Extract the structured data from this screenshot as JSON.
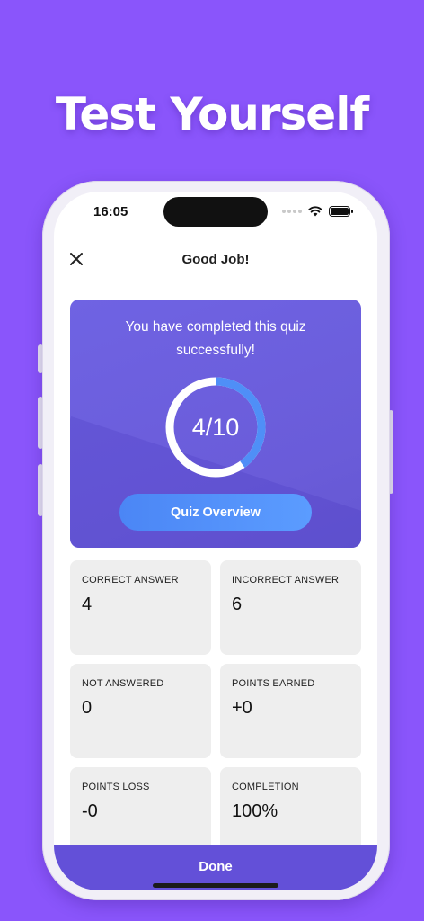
{
  "marketing": {
    "headline": "Test Yourself"
  },
  "status_bar": {
    "time": "16:05"
  },
  "nav": {
    "title": "Good Job!",
    "close_icon": "close-icon"
  },
  "result": {
    "message": "You have completed this quiz successfully!",
    "score_text": "4/10",
    "score_fraction": 0.4,
    "overview_button": "Quiz Overview"
  },
  "stats": [
    {
      "label": "CORRECT ANSWER",
      "value": "4"
    },
    {
      "label": "INCORRECT ANSWER",
      "value": "6"
    },
    {
      "label": "NOT ANSWERED",
      "value": "0"
    },
    {
      "label": "POINTS EARNED",
      "value": "+0"
    },
    {
      "label": "POINTS LOSS",
      "value": "-0"
    },
    {
      "label": "COMPLETION",
      "value": "100%"
    }
  ],
  "footer": {
    "done_label": "Done"
  },
  "colors": {
    "background": "#8a55fb",
    "card": "#6a5cd9",
    "accent_blue": "#4f8ff7",
    "done_bar": "#6350d8"
  }
}
